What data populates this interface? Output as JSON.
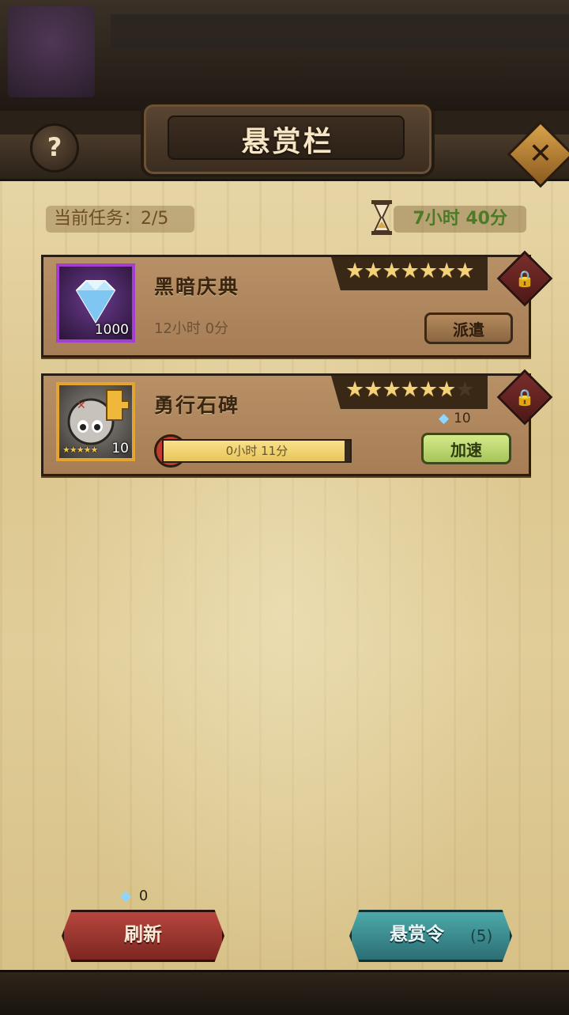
{
  "header": {
    "title": "悬赏栏",
    "help_icon": "question-mark-icon",
    "close_icon": "close-x-icon"
  },
  "status": {
    "task_count": "当前任务：2/5",
    "refresh_timer": "7小时 40分"
  },
  "tasks": [
    {
      "name": "黑暗庆典",
      "reward_icon": "diamond-icon",
      "reward_qty": "1000",
      "stars": 7,
      "stars_max": 7,
      "duration": "12小时 0分",
      "action_label": "派遣",
      "locked": true
    },
    {
      "name": "勇行石碑",
      "reward_icon": "hero-fragment-icon",
      "reward_qty": "10",
      "hero_stars": "★★★★★",
      "stars": 6,
      "stars_max": 7,
      "progress_text": "0小时 11分",
      "progress": 0.97,
      "speedup_cost": "10",
      "action_label": "加速",
      "locked": true
    }
  ],
  "footer": {
    "refresh_cost": "0",
    "refresh_label": "刷新",
    "bounty_label": "悬赏令",
    "bounty_count": "(5)"
  },
  "colors": {
    "gem_card_border": "#a33fd0",
    "hero_card_border": "#e2a534",
    "timer_text": "#4d7a26",
    "refresh_button": "#b7463e",
    "bounty_button": "#4da9a9"
  }
}
